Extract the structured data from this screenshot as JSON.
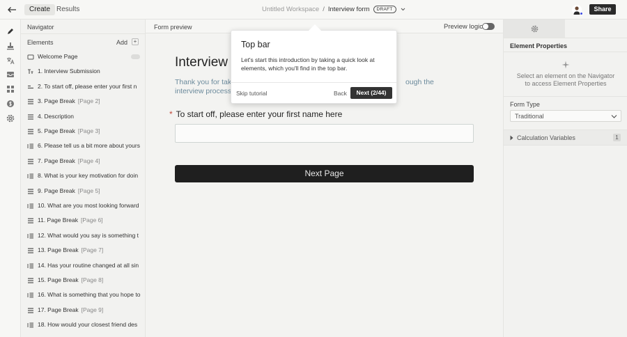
{
  "topbar": {
    "tabs": [
      {
        "label": "Create"
      },
      {
        "label": "Results"
      }
    ],
    "workspace": "Untitled Workspace",
    "separator": "/",
    "form_name": "Interview form",
    "status_badge": "DRAFT",
    "share_label": "Share"
  },
  "navigator": {
    "title": "Navigator",
    "elements_label": "Elements",
    "add_label": "Add",
    "add_plus": "+",
    "items": [
      {
        "icon": "page-icon",
        "text": "Welcome Page",
        "sub": ""
      },
      {
        "icon": "heading-icon",
        "text": "1.  Interview Submission",
        "sub": ""
      },
      {
        "icon": "short-text-icon",
        "text": "2.  To start off, please enter your first n",
        "sub": ""
      },
      {
        "icon": "page-break-icon",
        "text": "3.  Page Break",
        "sub": "[Page 2]"
      },
      {
        "icon": "page-break-icon",
        "text": "4.  Description",
        "sub": ""
      },
      {
        "icon": "page-break-icon",
        "text": "5.  Page Break",
        "sub": "[Page 3]"
      },
      {
        "icon": "long-text-icon",
        "text": "6.  Please tell us a bit more about yours",
        "sub": ""
      },
      {
        "icon": "page-break-icon",
        "text": "7.  Page Break",
        "sub": "[Page 4]"
      },
      {
        "icon": "long-text-icon",
        "text": "8.  What is your key motivation for doin",
        "sub": ""
      },
      {
        "icon": "page-break-icon",
        "text": "9.  Page Break",
        "sub": "[Page 5]"
      },
      {
        "icon": "long-text-icon",
        "text": "10.  What are you most looking forward",
        "sub": ""
      },
      {
        "icon": "page-break-icon",
        "text": "11.  Page Break",
        "sub": "[Page 6]"
      },
      {
        "icon": "long-text-icon",
        "text": "12.  What would you say is something t",
        "sub": ""
      },
      {
        "icon": "page-break-icon",
        "text": "13.  Page Break",
        "sub": "[Page 7]"
      },
      {
        "icon": "long-text-icon",
        "text": "14.  Has your routine changed at all sin",
        "sub": ""
      },
      {
        "icon": "page-break-icon",
        "text": "15.  Page Break",
        "sub": "[Page 8]"
      },
      {
        "icon": "long-text-icon",
        "text": "16.  What is something that you hope to",
        "sub": ""
      },
      {
        "icon": "page-break-icon",
        "text": "17.  Page Break",
        "sub": "[Page 9]"
      },
      {
        "icon": "long-text-icon",
        "text": "18.  How would your closest friend des",
        "sub": ""
      }
    ]
  },
  "preview": {
    "title": "Form preview",
    "logic_label": "Preview logic",
    "form_title_visible": "Interview S",
    "intro_line1": "Thank you for taki",
    "intro_line1_tail": "ough the",
    "intro_line2": "interview process.",
    "question_required": "*",
    "question_label": "To start off, please enter your first name here",
    "next_button": "Next Page"
  },
  "tutorial": {
    "title": "Top bar",
    "body": "Let's start this introduction by taking a quick look at elements, which you'll find in the top bar.",
    "skip_label": "Skip tutorial",
    "back_label": "Back",
    "next_label": "Next (2/44)"
  },
  "element_properties": {
    "title": "Element Properties",
    "hint": "Select an element on the Navigator to access Element Properties",
    "form_type_label": "Form Type",
    "form_type_value": "Traditional",
    "calc_vars_label": "Calculation Variables",
    "calc_vars_count": "1"
  },
  "colors": {
    "accent_dark": "#1f1f1f",
    "required": "#c24a3c",
    "intro_text": "#6b8a9c",
    "avatar_dot": "#3b49df"
  }
}
